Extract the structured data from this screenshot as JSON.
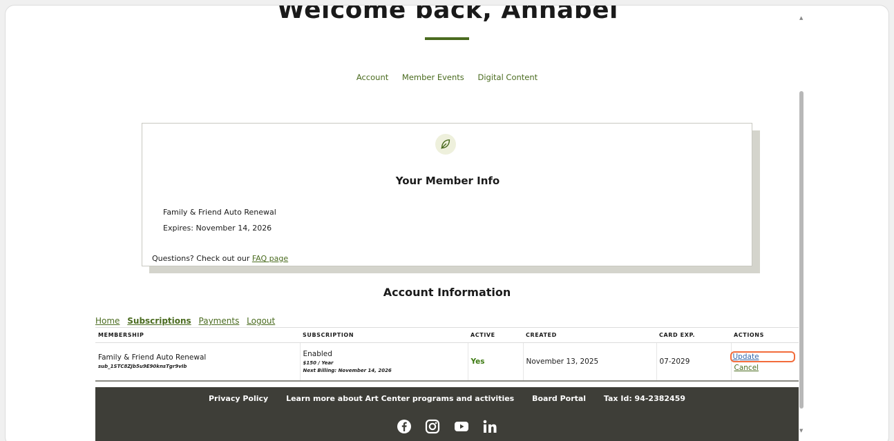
{
  "header": {
    "welcome": "Welcome back, Annabel"
  },
  "subnav": [
    "Account",
    "Member Events",
    "Digital Content"
  ],
  "member_card": {
    "icon": "leaf-icon",
    "title": "Your Member Info",
    "membership": "Family & Friend Auto Renewal",
    "expires": "Expires: November 14, 2026",
    "questions_text": "Questions? Check out our",
    "faq_link": "FAQ page"
  },
  "account": {
    "title": "Account Information",
    "tabs": [
      "Home",
      "Subscriptions",
      "Payments",
      "Logout"
    ],
    "active_tab": "Subscriptions"
  },
  "table": {
    "headers": [
      "MEMBERSHIP",
      "SUBSCRIPTION",
      "ACTIVE",
      "CREATED",
      "CARD EXP.",
      "ACTIONS"
    ],
    "row": {
      "membership_name": "Family & Friend Auto Renewal",
      "membership_id": "sub_1STC8ZJb5u9E90knsTgr9vIb",
      "subscription_status": "Enabled",
      "subscription_price": "$150 / Year",
      "next_billing": "Next Billing: November 14, 2026",
      "active": "Yes",
      "created": "November 13, 2025",
      "card_exp": "07-2029",
      "action_update": "Update",
      "action_cancel": "Cancel"
    }
  },
  "footer": {
    "links": [
      "Privacy Policy",
      "Learn more about Art Center programs and activities",
      "Board Portal",
      "Tax Id: 94-2382459"
    ],
    "social_icons": [
      "facebook-icon",
      "instagram-icon",
      "youtube-icon",
      "linkedin-icon"
    ]
  },
  "colors": {
    "accent": "#4a6b1f",
    "footer_bg": "#3e3e38",
    "highlight": "#f26b3a"
  }
}
